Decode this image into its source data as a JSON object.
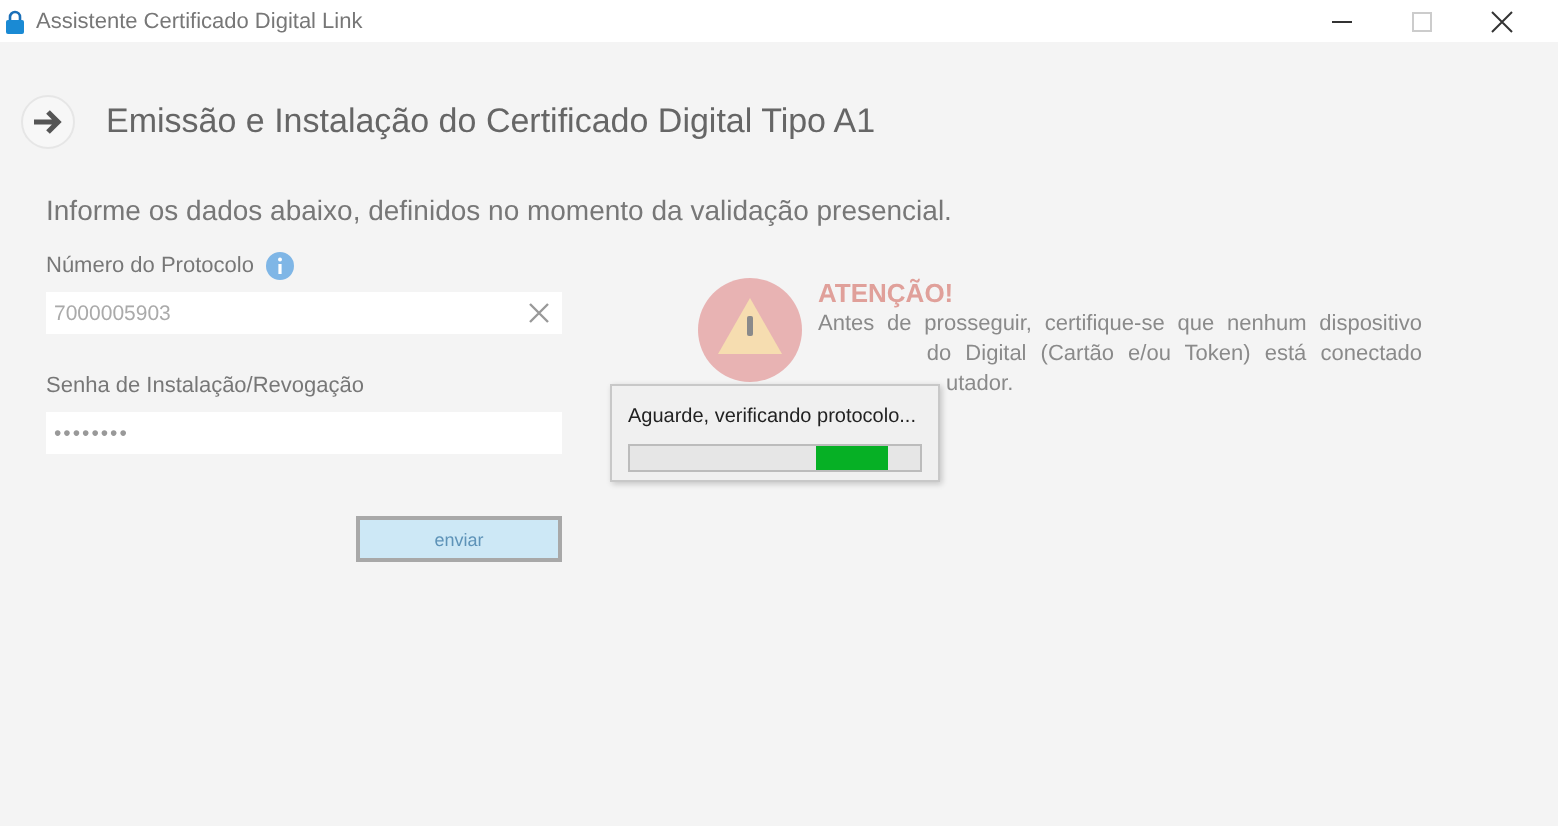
{
  "window": {
    "title": "Assistente Certificado Digital Link"
  },
  "page": {
    "title": "Emissão e Instalação do Certificado Digital Tipo A1",
    "instructions": "Informe os dados abaixo, definidos no momento da validação presencial."
  },
  "fields": [
    {
      "kind": "text",
      "label": "Número do Protocolo",
      "info": true,
      "value": "7000005903",
      "clearable": true
    },
    {
      "kind": "password",
      "label": "Senha de Instalação/Revogação",
      "info": false,
      "value": "••••••••",
      "clearable": false
    }
  ],
  "submit": {
    "label": "enviar",
    "disabled": true
  },
  "warning": {
    "title": "ATENÇÃO!",
    "lines": [
      "Antes de prosseguir, certifique-se que nenhum dispositivo",
      "do Digital (Cartão e/ou Token) está conectado",
      "utador."
    ]
  },
  "progress_dialog": {
    "message": "Aguarde, verificando protocolo...",
    "indeterminate": true
  }
}
